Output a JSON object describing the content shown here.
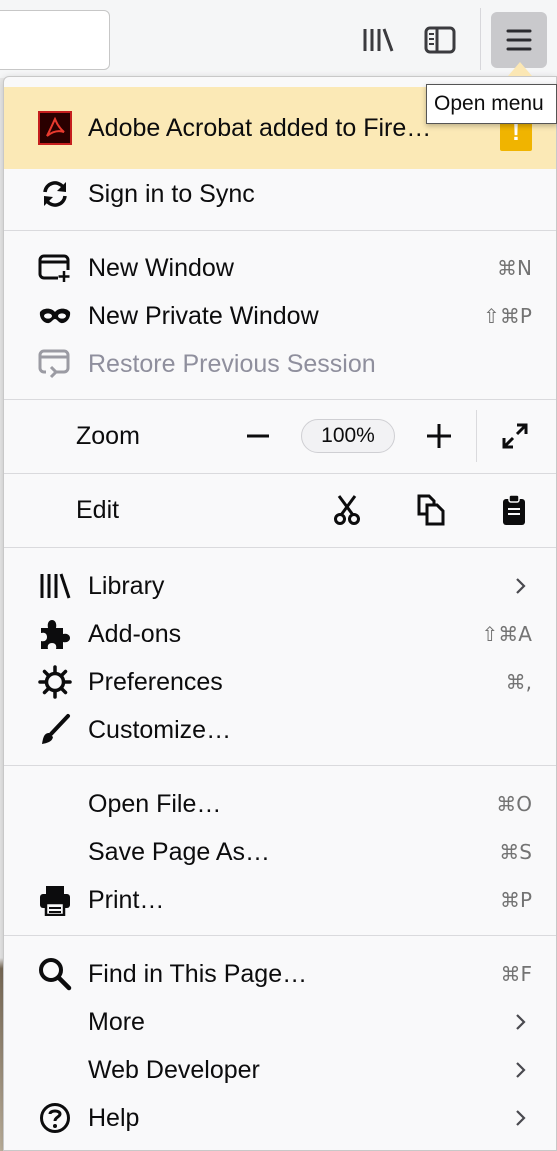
{
  "toolbar": {
    "library_icon": "library-icon",
    "sidebar_icon": "sidebar-icon",
    "menu_icon": "hamburger-menu-icon"
  },
  "tooltip": "Open menu",
  "banner": {
    "label": "Adobe Acrobat added to Fire…",
    "badge": "!",
    "icon": "adobe-acrobat-icon"
  },
  "items": {
    "sync": {
      "label": "Sign in to Sync",
      "icon": "sync-icon"
    },
    "new_window": {
      "label": "New Window",
      "shortcut": "⌘N",
      "icon": "new-window-icon"
    },
    "private_window": {
      "label": "New Private Window",
      "shortcut": "⇧⌘P",
      "icon": "private-mask-icon"
    },
    "restore": {
      "label": "Restore Previous Session",
      "icon": "restore-session-icon"
    },
    "zoom": {
      "label": "Zoom",
      "value": "100%"
    },
    "edit": {
      "label": "Edit"
    },
    "library": {
      "label": "Library",
      "icon": "library-icon"
    },
    "addons": {
      "label": "Add-ons",
      "shortcut": "⇧⌘A",
      "icon": "puzzle-icon"
    },
    "preferences": {
      "label": "Preferences",
      "shortcut": "⌘,",
      "icon": "gear-icon"
    },
    "customize": {
      "label": "Customize…",
      "icon": "paintbrush-icon"
    },
    "open_file": {
      "label": "Open File…",
      "shortcut": "⌘O"
    },
    "save_page": {
      "label": "Save Page As…",
      "shortcut": "⌘S"
    },
    "print": {
      "label": "Print…",
      "shortcut": "⌘P",
      "icon": "printer-icon"
    },
    "find": {
      "label": "Find in This Page…",
      "shortcut": "⌘F",
      "icon": "magnifier-icon"
    },
    "more": {
      "label": "More"
    },
    "web_dev": {
      "label": "Web Developer"
    },
    "help": {
      "label": "Help",
      "icon": "help-circle-icon"
    }
  }
}
